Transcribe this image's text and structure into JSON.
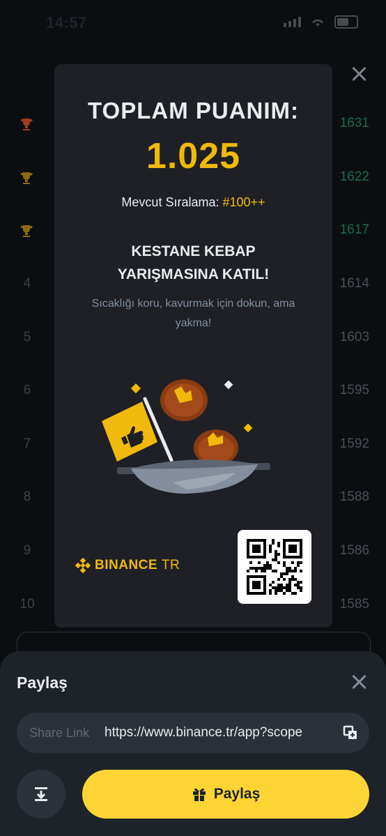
{
  "status_bar": {
    "time": "14:57"
  },
  "leaderboard": {
    "rows": [
      {
        "rank": "",
        "trophy": "gold-red",
        "score": "1631",
        "highlight": true
      },
      {
        "rank": "",
        "trophy": "gold",
        "score": "1622",
        "highlight": true
      },
      {
        "rank": "",
        "trophy": "gold",
        "score": "1617",
        "highlight": true
      },
      {
        "rank": "4",
        "score": "1614"
      },
      {
        "rank": "5",
        "score": "1603"
      },
      {
        "rank": "6",
        "score": "1595"
      },
      {
        "rank": "7",
        "score": "1592"
      },
      {
        "rank": "8",
        "score": "1588"
      },
      {
        "rank": "9",
        "score": "1586"
      },
      {
        "rank": "10",
        "score": "1585"
      }
    ]
  },
  "card": {
    "title": "TOPLAM PUANIM:",
    "score": "1.025",
    "ranking_label": "Mevcut Sıralama:",
    "ranking_value": "#100++",
    "headline_line1": "KESTANE KEBAP",
    "headline_line2": "YARIŞMASINA KATIL!",
    "description": "Sıcaklığı koru, kavurmak için dokun, ama yakma!",
    "brand_name": "BINANCE",
    "brand_suffix": "TR"
  },
  "share_sheet": {
    "title": "Paylaş",
    "link_label": "Share Link",
    "link_value": "https://www.binance.tr/app?scope",
    "share_button_label": "Paylaş"
  },
  "colors": {
    "accent_yellow": "#f0b90b",
    "button_yellow": "#fcd535",
    "green": "#1a6b47",
    "card_bg": "#1e2026"
  },
  "icons": [
    "close-icon",
    "trophy-icon",
    "binance-logo-icon",
    "qr-code-icon",
    "copy-icon",
    "download-icon",
    "gift-icon"
  ]
}
